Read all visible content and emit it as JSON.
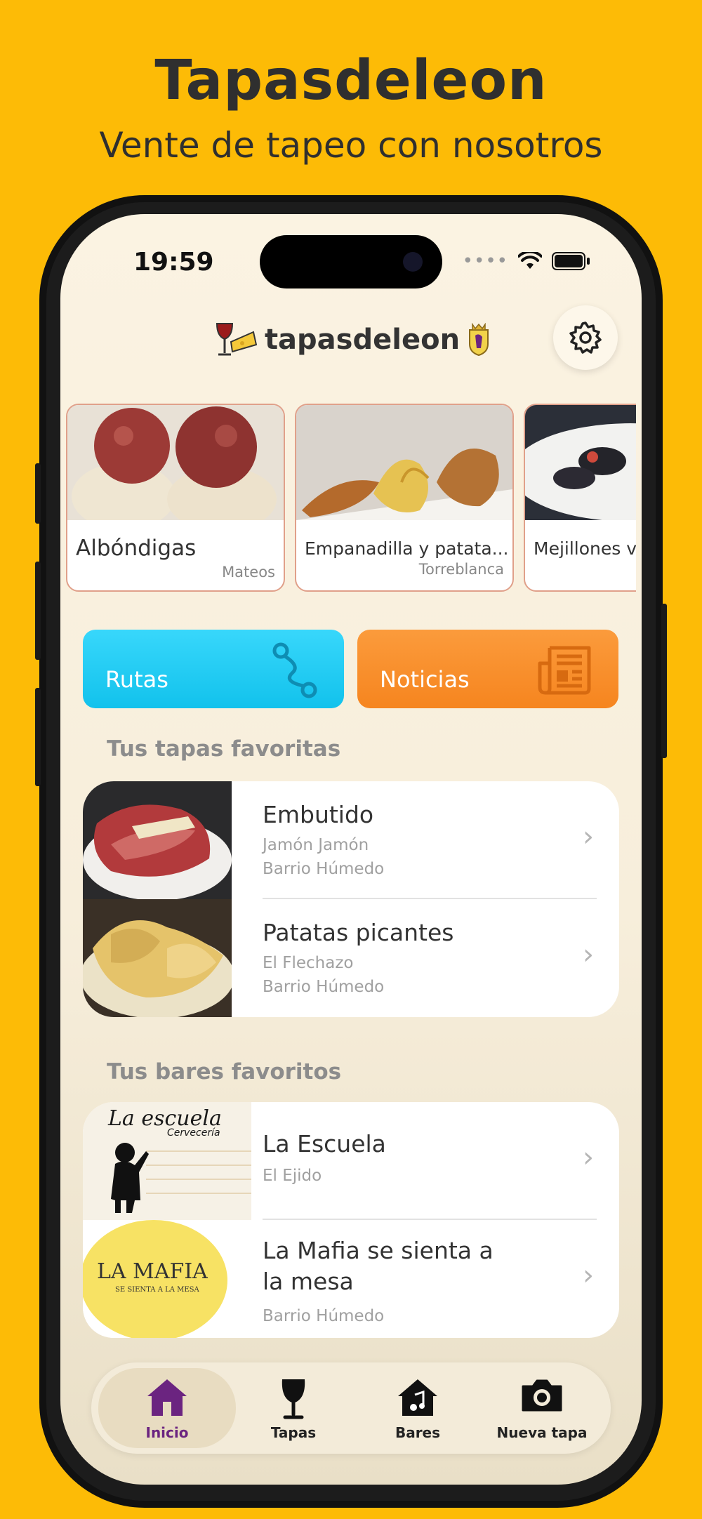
{
  "promo": {
    "title": "Tapasdeleon",
    "subtitle": "Vente de tapeo con nosotros"
  },
  "status_bar": {
    "time": "19:59"
  },
  "header": {
    "brand": "tapasdeleon",
    "settings_icon": "gear-icon"
  },
  "carousel": [
    {
      "name": "Albóndigas",
      "bar": "Mateos"
    },
    {
      "name": "Empanadilla y patata...",
      "bar": "Torreblanca"
    },
    {
      "name": "Mejillones vi",
      "bar": ""
    }
  ],
  "tiles": [
    {
      "label": "Rutas",
      "color": "#1EC8F2",
      "icon": "route-icon"
    },
    {
      "label": "Noticias",
      "color": "#F98C2A",
      "icon": "newspaper-icon"
    }
  ],
  "favorite_tapas": {
    "heading": "Tus tapas favoritas",
    "items": [
      {
        "title": "Embutido",
        "bar": "Jamón Jamón",
        "area": "Barrio Húmedo"
      },
      {
        "title": "Patatas picantes",
        "bar": "El Flechazo",
        "area": "Barrio Húmedo"
      }
    ]
  },
  "favorite_bars": {
    "heading": "Tus bares favoritos",
    "items": [
      {
        "title": "La Escuela",
        "area": "El Ejido",
        "logo_text": "La escuela",
        "logo_sub": "Cervecería"
      },
      {
        "title_line1": "La Mafia se sienta a",
        "title_line2": "la mesa",
        "area": "Barrio Húmedo",
        "logo_text": "LA MAFIA",
        "logo_sub": "SE SIENTA A LA MESA"
      }
    ]
  },
  "tabbar": {
    "active": "Inicio",
    "active_color": "#6B2480",
    "items": [
      {
        "label": "Inicio",
        "icon": "home-icon"
      },
      {
        "label": "Tapas",
        "icon": "wine-glass-icon"
      },
      {
        "label": "Bares",
        "icon": "music-house-icon"
      },
      {
        "label": "Nueva tapa",
        "icon": "camera-icon"
      }
    ]
  }
}
